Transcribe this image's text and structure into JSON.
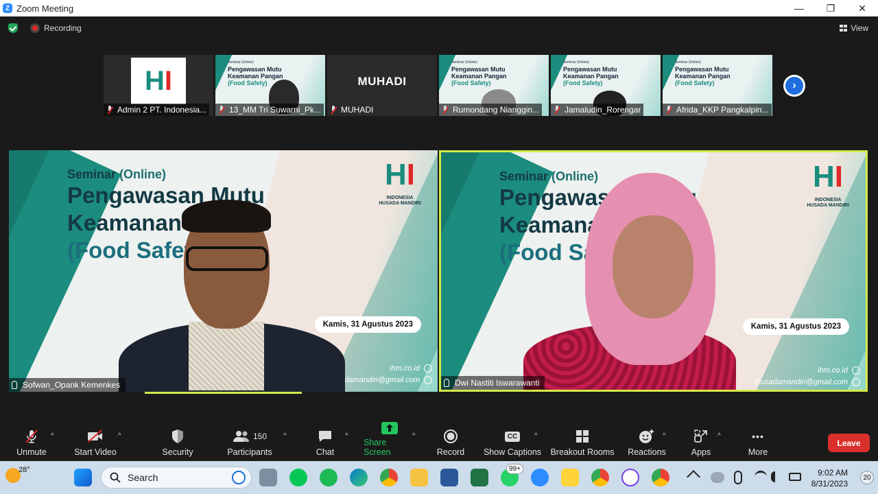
{
  "window": {
    "title": "Zoom Meeting",
    "logo_glyph": "Z",
    "minimize": "—",
    "restore": "❐",
    "close": "✕"
  },
  "status": {
    "recording_label": "Recording",
    "view_label": "View"
  },
  "thumbnails": [
    {
      "name": "Admin 2 PT. Indonesia...",
      "type": "logo"
    },
    {
      "name": "13_MM Tri Suwarni_Pk...",
      "type": "slide-person"
    },
    {
      "name": "MUHADI",
      "type": "text",
      "display": "MUHADI"
    },
    {
      "name": "Rumondang Nianggin...",
      "type": "slide-person"
    },
    {
      "name": "Jamaludin_Rorengar",
      "type": "slide-person"
    },
    {
      "name": "Afrida_KKP Pangkalpin...",
      "type": "slide"
    }
  ],
  "thumb_slide": {
    "line1": "Seminar (Online)",
    "line2": "Pengawasan Mutu",
    "line3": "Keamanan Pangan",
    "line4": "(Food Safety)"
  },
  "next_glyph": "›",
  "slide": {
    "seminar_prefix": "Seminar ",
    "seminar_suffix": "(Online)",
    "title1": "Pengawasan Mutu",
    "title2": "Keamanan Pangan",
    "title3": "(Food Safety)",
    "date": "Kamis, 31 Agustus 2023",
    "website": "ihm.co.id",
    "email": "ihusadamandiri@gmail.com",
    "logo_line1": "INDONESIA",
    "logo_line2": "HUSADA MANDIRI"
  },
  "videos": [
    {
      "name": "Sofwan_Opank Kemenkes"
    },
    {
      "name": "Dwi Nastiti Iswarawanti"
    }
  ],
  "toolbar": {
    "unmute": "Unmute",
    "start_video": "Start Video",
    "security": "Security",
    "participants": "Participants",
    "participants_count": "150",
    "chat": "Chat",
    "share_screen": "Share Screen",
    "record": "Record",
    "show_captions": "Show Captions",
    "cc": "CC",
    "breakout_rooms": "Breakout Rooms",
    "reactions": "Reactions",
    "apps": "Apps",
    "more": "More",
    "more_glyph": "•••",
    "leave": "Leave",
    "caret": "^"
  },
  "taskbar": {
    "temperature": "28°",
    "search_placeholder": "Search",
    "whatsapp_badge": "99+",
    "time": "9:02 AM",
    "date": "8/31/2023",
    "notifications": "20"
  },
  "colors": {
    "accent_green": "#23c55e",
    "leave_red": "#d9302b",
    "active_speaker": "#d4e94a",
    "slide_teal": "#1b8c7d"
  }
}
